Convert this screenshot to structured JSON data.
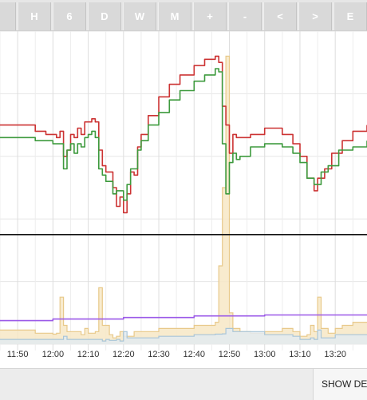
{
  "toolbar": {
    "buttons": [
      {
        "label": "H"
      },
      {
        "label": "6"
      },
      {
        "label": "D"
      },
      {
        "label": "W"
      },
      {
        "label": "M"
      },
      {
        "label": "+"
      },
      {
        "label": "-"
      },
      {
        "label": "<"
      },
      {
        "label": ">"
      },
      {
        "label": "E"
      }
    ]
  },
  "footer": {
    "show_details_label": "SHOW DE"
  },
  "chart_data": {
    "type": "line",
    "x_tick_labels": [
      "11:50",
      "12:00",
      "12:10",
      "12:20",
      "12:30",
      "12:40",
      "12:50",
      "13:00",
      "13:10",
      "13:20"
    ],
    "x_range": [
      "11:45",
      "13:29"
    ],
    "y_range": [
      0,
      100
    ],
    "grid": true,
    "reference_line": 35,
    "series": [
      {
        "color": "#cc3333",
        "style": "line",
        "points": [
          [
            "11:45",
            70
          ],
          [
            "11:55",
            68
          ],
          [
            "11:58",
            67
          ],
          [
            "12:01",
            66
          ],
          [
            "12:02",
            68
          ],
          [
            "12:03",
            60
          ],
          [
            "12:04",
            62
          ],
          [
            "12:05",
            67
          ],
          [
            "12:06",
            66
          ],
          [
            "12:07",
            69
          ],
          [
            "12:08",
            67
          ],
          [
            "12:09",
            71
          ],
          [
            "12:10",
            71
          ],
          [
            "12:11",
            72
          ],
          [
            "12:12",
            71
          ],
          [
            "12:13",
            62
          ],
          [
            "12:14",
            57
          ],
          [
            "12:15",
            55
          ],
          [
            "12:17",
            50
          ],
          [
            "12:18",
            44
          ],
          [
            "12:19",
            47
          ],
          [
            "12:20",
            42
          ],
          [
            "12:21",
            48
          ],
          [
            "12:22",
            55
          ],
          [
            "12:23",
            54
          ],
          [
            "12:24",
            63
          ],
          [
            "12:25",
            67
          ],
          [
            "12:27",
            73
          ],
          [
            "12:30",
            79
          ],
          [
            "12:33",
            83
          ],
          [
            "12:36",
            86
          ],
          [
            "12:40",
            89
          ],
          [
            "12:43",
            91
          ],
          [
            "12:46",
            92
          ],
          [
            "12:47",
            90
          ],
          [
            "12:48",
            76
          ],
          [
            "12:49",
            70
          ],
          [
            "12:50",
            61
          ],
          [
            "12:51",
            67
          ],
          [
            "12:52",
            66
          ],
          [
            "12:53",
            66
          ],
          [
            "12:56",
            67
          ],
          [
            "13:00",
            69
          ],
          [
            "13:05",
            67
          ],
          [
            "13:08",
            64
          ],
          [
            "13:10",
            60
          ],
          [
            "13:12",
            53
          ],
          [
            "13:14",
            49
          ],
          [
            "13:15",
            53
          ],
          [
            "13:17",
            56
          ],
          [
            "13:19",
            61
          ],
          [
            "13:22",
            65
          ],
          [
            "13:25",
            68
          ],
          [
            "13:29",
            70
          ]
        ]
      },
      {
        "color": "#3d9a3d",
        "style": "line",
        "points": [
          [
            "11:45",
            66
          ],
          [
            "11:55",
            65
          ],
          [
            "12:00",
            64
          ],
          [
            "12:02",
            64
          ],
          [
            "12:03",
            56
          ],
          [
            "12:04",
            62
          ],
          [
            "12:05",
            64
          ],
          [
            "12:06",
            61
          ],
          [
            "12:07",
            64
          ],
          [
            "12:08",
            63
          ],
          [
            "12:09",
            66
          ],
          [
            "12:10",
            67
          ],
          [
            "12:11",
            68
          ],
          [
            "12:12",
            66
          ],
          [
            "12:13",
            56
          ],
          [
            "12:14",
            54
          ],
          [
            "12:15",
            52
          ],
          [
            "12:17",
            48
          ],
          [
            "12:18",
            49
          ],
          [
            "12:20",
            46
          ],
          [
            "12:21",
            51
          ],
          [
            "12:22",
            56
          ],
          [
            "12:24",
            62
          ],
          [
            "12:25",
            65
          ],
          [
            "12:27",
            70
          ],
          [
            "12:30",
            74
          ],
          [
            "12:33",
            78
          ],
          [
            "12:36",
            81
          ],
          [
            "12:40",
            84
          ],
          [
            "12:43",
            86
          ],
          [
            "12:46",
            88
          ],
          [
            "12:47",
            87
          ],
          [
            "12:48",
            64
          ],
          [
            "12:49",
            48
          ],
          [
            "12:50",
            58
          ],
          [
            "12:51",
            61
          ],
          [
            "12:52",
            59
          ],
          [
            "12:53",
            60
          ],
          [
            "12:56",
            63
          ],
          [
            "13:00",
            64
          ],
          [
            "13:05",
            63
          ],
          [
            "13:08",
            61
          ],
          [
            "13:10",
            58
          ],
          [
            "13:12",
            53
          ],
          [
            "13:14",
            51
          ],
          [
            "13:16",
            55
          ],
          [
            "13:18",
            57
          ],
          [
            "13:21",
            62
          ],
          [
            "13:25",
            63
          ],
          [
            "13:29",
            65
          ]
        ]
      },
      {
        "color": "#9b59e8",
        "style": "line",
        "points": [
          [
            "11:45",
            7.5
          ],
          [
            "12:00",
            8
          ],
          [
            "12:20",
            8.5
          ],
          [
            "12:40",
            9
          ],
          [
            "13:00",
            9.3
          ],
          [
            "13:29",
            9.5
          ]
        ]
      },
      {
        "color": "#e8c98a",
        "fill": "#f7e7c6",
        "style": "area",
        "points": [
          [
            "11:45",
            4.5
          ],
          [
            "11:55",
            3.5
          ],
          [
            "12:00",
            3.2
          ],
          [
            "12:01",
            3.5
          ],
          [
            "12:02",
            15
          ],
          [
            "12:03",
            6
          ],
          [
            "12:04",
            4
          ],
          [
            "12:08",
            3
          ],
          [
            "12:09",
            5
          ],
          [
            "12:10",
            3.5
          ],
          [
            "12:12",
            4
          ],
          [
            "12:13",
            18
          ],
          [
            "12:14",
            6
          ],
          [
            "12:16",
            3
          ],
          [
            "12:17",
            2
          ],
          [
            "12:18",
            2.5
          ],
          [
            "12:19",
            4
          ],
          [
            "12:20",
            2.5
          ],
          [
            "12:23",
            4
          ],
          [
            "12:30",
            5
          ],
          [
            "12:40",
            6
          ],
          [
            "12:46",
            7
          ],
          [
            "12:47",
            25
          ],
          [
            "12:48",
            50
          ],
          [
            "12:49",
            92
          ],
          [
            "12:50",
            10
          ],
          [
            "12:51",
            5
          ],
          [
            "12:53",
            4
          ],
          [
            "12:56",
            3.5
          ],
          [
            "13:00",
            4
          ],
          [
            "13:05",
            5
          ],
          [
            "13:08",
            4
          ],
          [
            "13:10",
            2.5
          ],
          [
            "13:12",
            3
          ],
          [
            "13:13",
            6
          ],
          [
            "13:14",
            4
          ],
          [
            "13:15",
            15
          ],
          [
            "13:16",
            5
          ],
          [
            "13:18",
            3.5
          ],
          [
            "13:20",
            5
          ],
          [
            "13:22",
            6
          ],
          [
            "13:25",
            7
          ],
          [
            "13:29",
            7
          ]
        ]
      },
      {
        "color": "#a8c5d8",
        "fill": "#e3ebf0",
        "style": "area",
        "points": [
          [
            "11:45",
            1.5
          ],
          [
            "11:55",
            1.5
          ],
          [
            "12:02",
            1.5
          ],
          [
            "12:03",
            2.5
          ],
          [
            "12:04",
            1.5
          ],
          [
            "12:10",
            1.5
          ],
          [
            "12:12",
            1.5
          ],
          [
            "12:14",
            1
          ],
          [
            "12:15",
            1.5
          ],
          [
            "12:16",
            1.2
          ],
          [
            "12:18",
            1.5
          ],
          [
            "12:19",
            1
          ],
          [
            "12:20",
            4
          ],
          [
            "12:21",
            2
          ],
          [
            "12:30",
            2.5
          ],
          [
            "12:40",
            3
          ],
          [
            "12:46",
            3.2
          ],
          [
            "12:48",
            3.3
          ],
          [
            "12:49",
            5
          ],
          [
            "12:50",
            5
          ],
          [
            "12:51",
            4
          ],
          [
            "12:55",
            4
          ],
          [
            "13:00",
            3
          ],
          [
            "13:08",
            2.5
          ],
          [
            "13:10",
            1.5
          ],
          [
            "13:12",
            1.5
          ],
          [
            "13:13",
            2
          ],
          [
            "13:14",
            1.5
          ],
          [
            "13:15",
            4.5
          ],
          [
            "13:16",
            2
          ],
          [
            "13:20",
            3
          ],
          [
            "13:29",
            3
          ]
        ]
      }
    ]
  }
}
